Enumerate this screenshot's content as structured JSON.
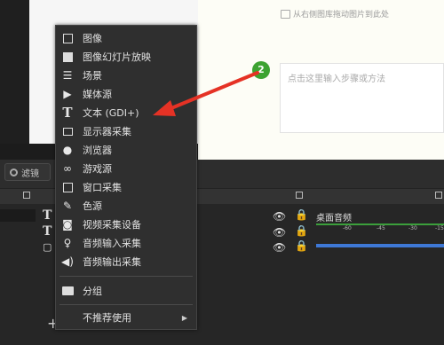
{
  "document": {
    "hint": "从右侧图库拖动图片到此处",
    "step_badge": "2",
    "step_placeholder": "点击这里输入步骤或方法"
  },
  "toolbar": {
    "filter_label": "滤镜"
  },
  "mixer": {
    "channel_label": "桌面音频",
    "scale_ticks": [
      "-60",
      "-45",
      "-30",
      "-15"
    ]
  },
  "sources": {
    "add_symbol": "+"
  },
  "menu": {
    "items": [
      {
        "label": "图像",
        "icon": "image-icon"
      },
      {
        "label": "图像幻灯片放映",
        "icon": "slideshow-icon"
      },
      {
        "label": "场景",
        "icon": "scene-list-icon"
      },
      {
        "label": "媒体源",
        "icon": "play-icon"
      },
      {
        "label": "文本 (GDI+)",
        "icon": "text-icon"
      },
      {
        "label": "显示器采集",
        "icon": "monitor-icon"
      },
      {
        "label": "浏览器",
        "icon": "globe-icon"
      },
      {
        "label": "游戏源",
        "icon": "gamepad-icon"
      },
      {
        "label": "窗口采集",
        "icon": "window-icon"
      },
      {
        "label": "色源",
        "icon": "brush-icon"
      },
      {
        "label": "视频采集设备",
        "icon": "camera-icon"
      },
      {
        "label": "音频输入采集",
        "icon": "microphone-icon"
      },
      {
        "label": "音频输出采集",
        "icon": "speaker-icon"
      },
      {
        "label": "分组",
        "icon": "folder-icon"
      },
      {
        "label": "不推荐使用",
        "icon": ""
      }
    ]
  },
  "colors": {
    "badge_green": "#3da332",
    "arrow_red": "#e53225",
    "meter_green": "#3b9f3b",
    "meter_blue": "#3e78d6"
  }
}
